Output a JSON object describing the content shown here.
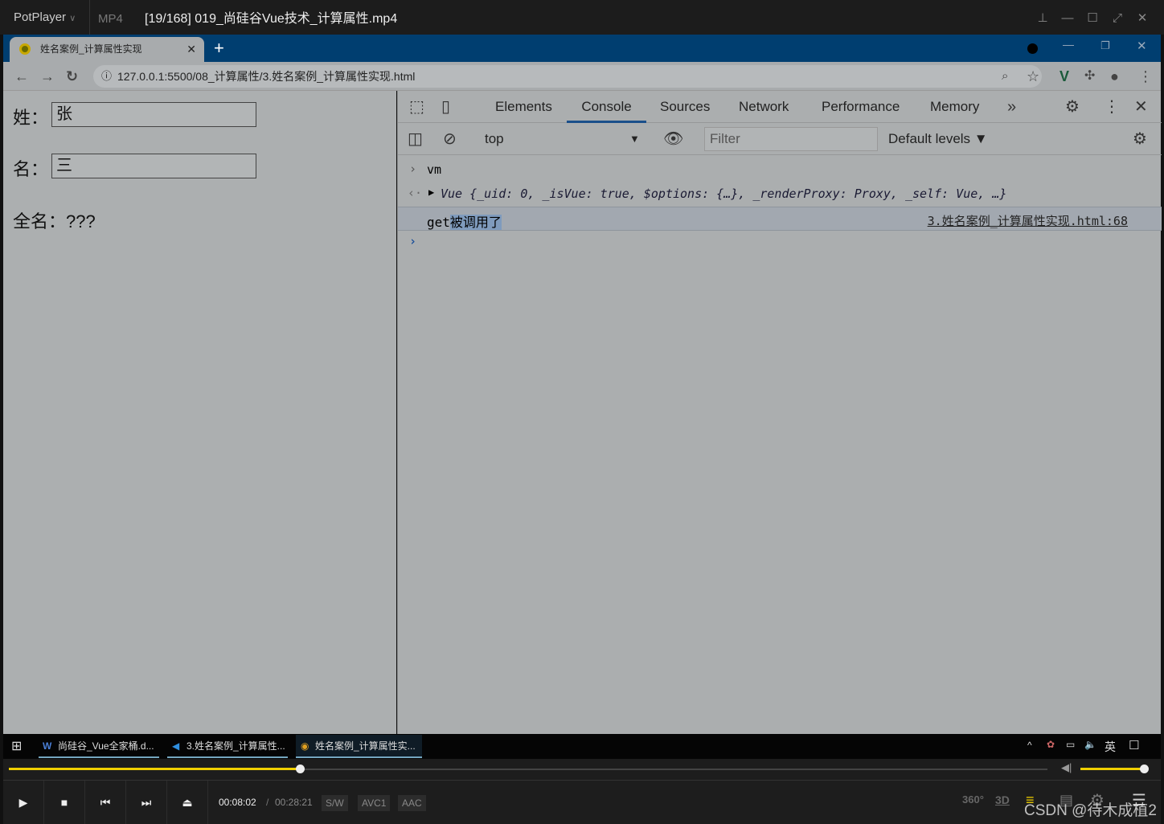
{
  "player": {
    "brand": "PotPlayer",
    "format": "MP4",
    "title": "[19/168] 019_尚硅谷Vue技术_计算属性.mp4",
    "time_current": "00:08:02",
    "time_total": "00:28:21",
    "badges": [
      "S/W",
      "AVC1",
      "AAC"
    ],
    "progress_fraction": 0.28,
    "volume_fraction": 1.0,
    "right_icons": [
      "360°",
      "3D"
    ]
  },
  "browser": {
    "tab_title": "姓名案例_计算属性实现",
    "url": "127.0.0.1:5500/08_计算属性/3.姓名案例_计算属性实现.html"
  },
  "page": {
    "last_label": "姓：",
    "last_value": "张",
    "first_label": "名：",
    "first_value": "三",
    "full_label": "全名：???"
  },
  "devtools": {
    "tabs": [
      "Elements",
      "Console",
      "Sources",
      "Network",
      "Performance",
      "Memory"
    ],
    "active_tab": "Console",
    "context": "top",
    "filter_placeholder": "Filter",
    "levels": "Default levels ▼",
    "console": {
      "input": "vm",
      "result": "Vue {_uid: 0, _isVue: true, $options: {…}, _renderProxy: Proxy, _self: Vue, …}",
      "log_prefix": "get",
      "log_selected": "被调用了",
      "log_source": "3.姓名案例_计算属性实现.html:68"
    }
  },
  "taskbar": {
    "items": [
      "尚硅谷_Vue全家桶.d...",
      "3.姓名案例_计算属性...",
      "姓名案例_计算属性实..."
    ],
    "ime": "英"
  },
  "watermark": "CSDN @待木成植2",
  "colors": {
    "accent_yellow": "#f0d000",
    "chrome_blue": "#003e70"
  }
}
